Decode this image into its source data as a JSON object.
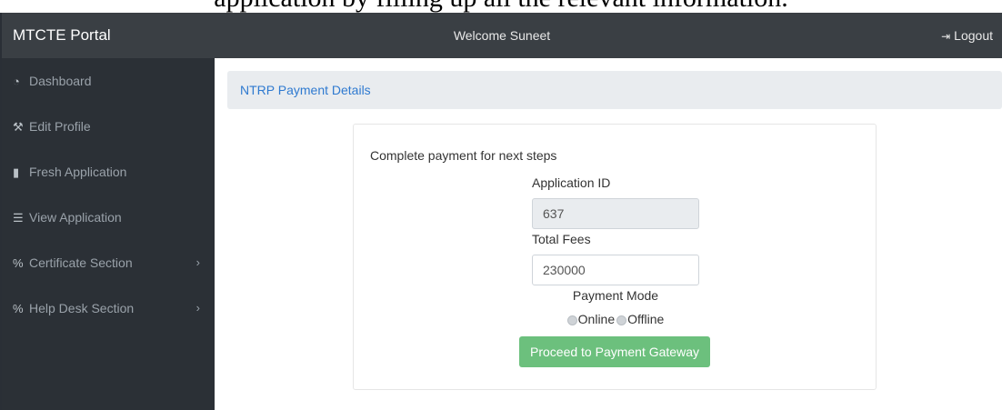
{
  "document": {
    "caption_fragment": "application by filling up all the relevant information."
  },
  "topbar": {
    "brand": "MTCTE Portal",
    "welcome": "Welcome Suneet",
    "logout_label": "Logout",
    "logout_icon": "sign-out-icon"
  },
  "sidebar": {
    "items": [
      {
        "label": "Dashboard",
        "icon": "dashboard-icon"
      },
      {
        "label": "Edit Profile",
        "icon": "wrench-icon"
      },
      {
        "label": "Fresh Application",
        "icon": "file-icon"
      },
      {
        "label": "View Application",
        "icon": "list-icon"
      },
      {
        "label": "Certificate Section",
        "icon": "link-icon",
        "has_submenu": true
      },
      {
        "label": "Help Desk Section",
        "icon": "link-icon",
        "has_submenu": true
      }
    ]
  },
  "main": {
    "panel_title": "NTRP Payment Details",
    "intro": "Complete payment for next steps",
    "application_id_label": "Application ID",
    "application_id_value": "637",
    "total_fees_label": "Total Fees",
    "total_fees_value": "230000",
    "payment_mode_label": "Payment Mode",
    "payment_options": [
      "Online",
      "Offline"
    ],
    "submit_label": "Proceed to Payment Gateway"
  },
  "colors": {
    "topbar_bg": "#3a3f44",
    "sidebar_bg": "#2b3036",
    "link_blue": "#2f7ad0",
    "button_green": "#6cc07d"
  }
}
